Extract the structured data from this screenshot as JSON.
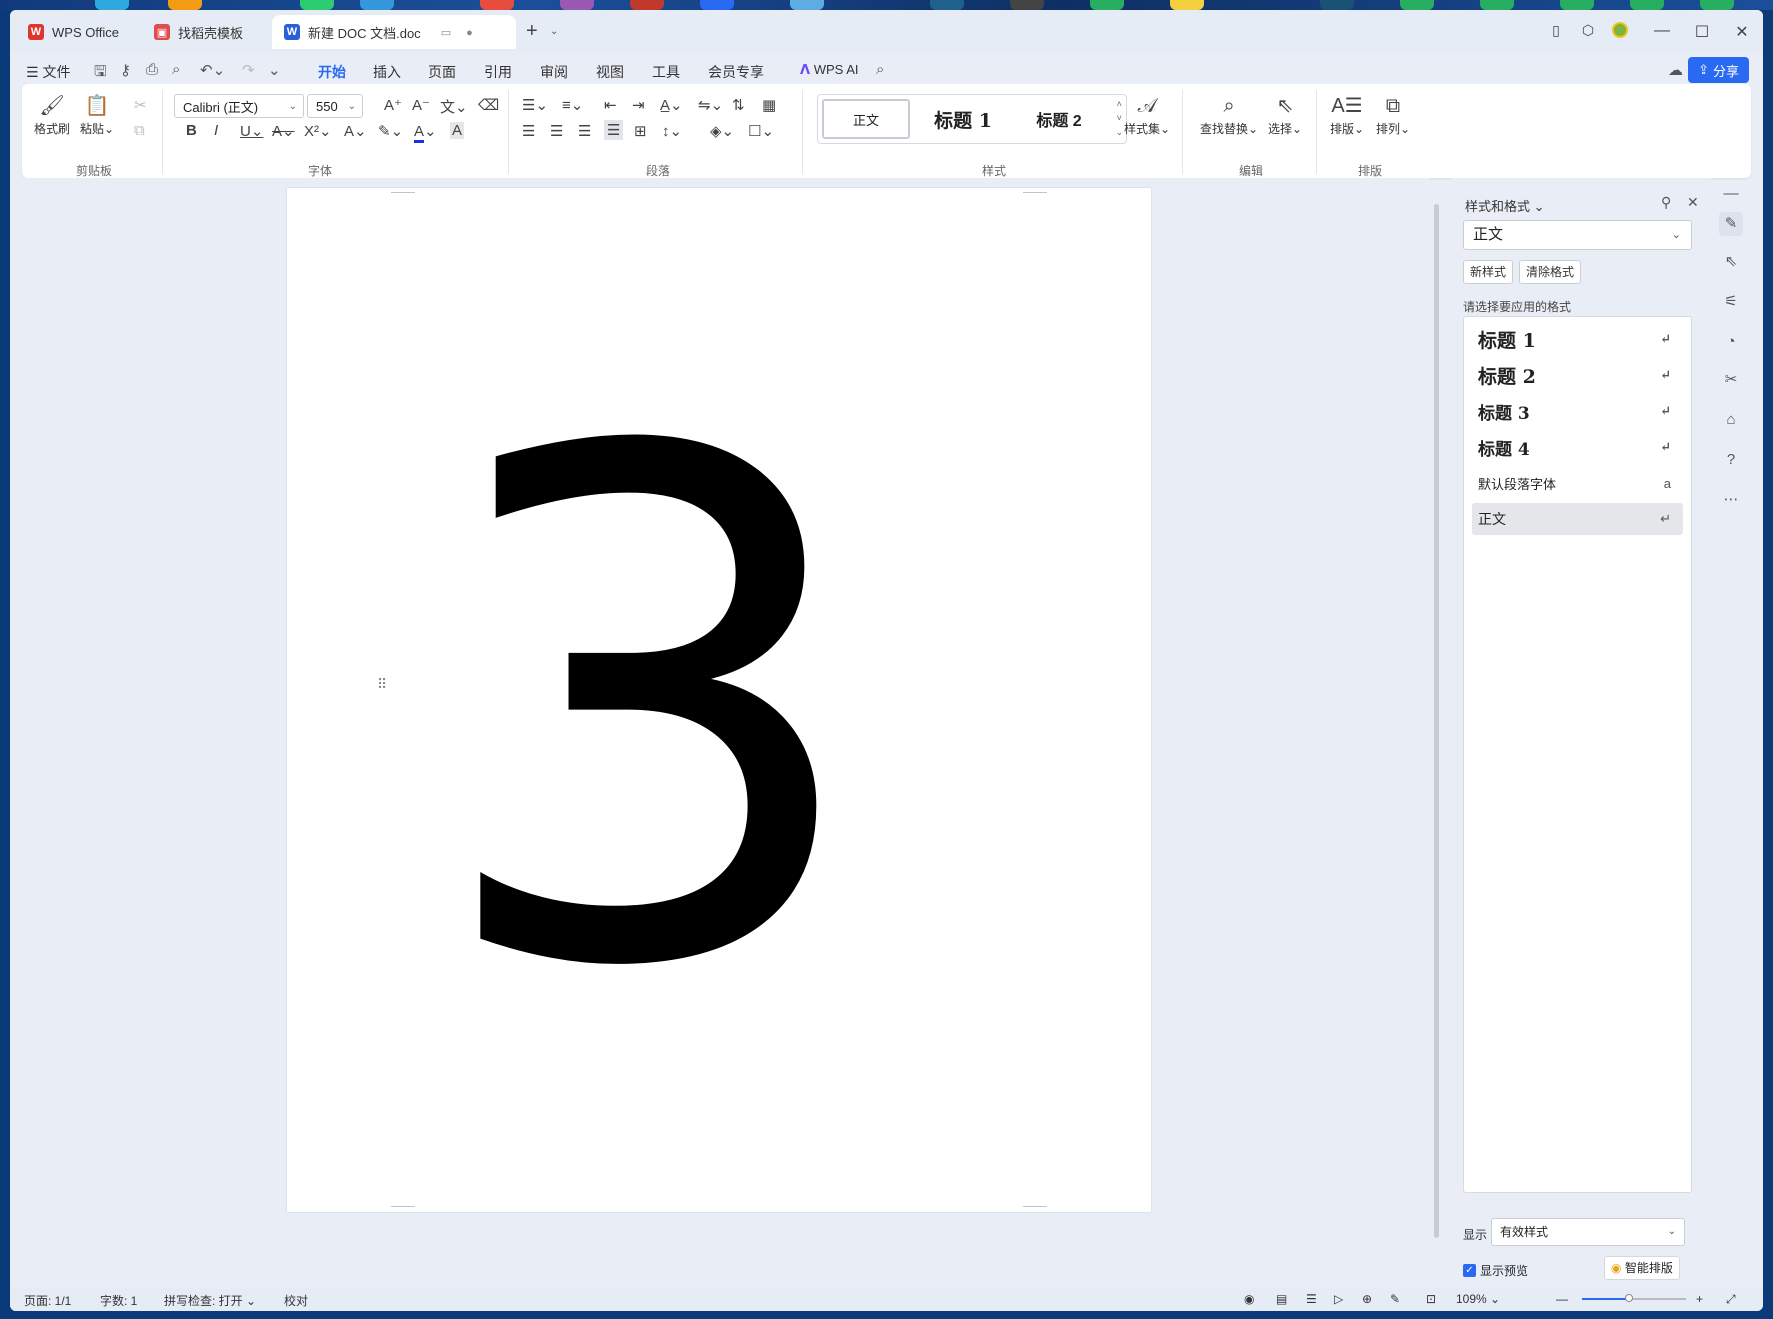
{
  "tabs": [
    {
      "label": "WPS Office",
      "icon": "wps-logo-icon"
    },
    {
      "label": "找稻壳模板",
      "icon": "daoke-icon"
    },
    {
      "label": "新建 DOC 文档.doc",
      "icon": "word-doc-icon",
      "active": true
    }
  ],
  "menu": {
    "file": "文件",
    "items": [
      "开始",
      "插入",
      "页面",
      "引用",
      "审阅",
      "视图",
      "工具",
      "会员专享"
    ],
    "active": "开始",
    "ai": "WPS AI",
    "share": "分享"
  },
  "ribbon": {
    "clipboard": {
      "format_painter": "格式刷",
      "paste": "粘贴",
      "group": "剪贴板"
    },
    "font": {
      "name": "Calibri (正文)",
      "size": "550",
      "group": "字体"
    },
    "paragraph": {
      "group": "段落"
    },
    "styles": {
      "normal": "正文",
      "h1": "标题 1",
      "h2": "标题 2",
      "set": "样式集",
      "group": "样式"
    },
    "edit": {
      "find_replace": "查找替换",
      "select": "选择",
      "group": "编辑"
    },
    "layout": {
      "typeset": "排版",
      "arrange": "排列",
      "group": "排版"
    }
  },
  "document": {
    "content": "3"
  },
  "panel": {
    "title": "样式和格式",
    "current_style": "正文",
    "new_style": "新样式",
    "clear_format": "清除格式",
    "choose_label": "请选择要应用的格式",
    "styles": [
      {
        "label": "标题 1",
        "mark": "↵"
      },
      {
        "label": "标题 2",
        "mark": "↵"
      },
      {
        "label": "标题 3",
        "mark": "↵"
      },
      {
        "label": "标题 4",
        "mark": "↵"
      },
      {
        "label": "默认段落字体",
        "mark": "a"
      },
      {
        "label": "正文",
        "mark": "↵",
        "selected": true
      }
    ],
    "show_label": "显示",
    "show_value": "有效样式",
    "show_preview": "显示预览",
    "smart_layout": "智能排版"
  },
  "status": {
    "page": "页面: 1/1",
    "words": "字数: 1",
    "spell": "拼写检查: 打开",
    "proof": "校对",
    "zoom": "109%",
    "zoom_fraction": 0.45
  },
  "colors": {
    "accent": "#2a6af2",
    "wps_red": "#e0352f",
    "word_blue": "#2b5fd9"
  }
}
